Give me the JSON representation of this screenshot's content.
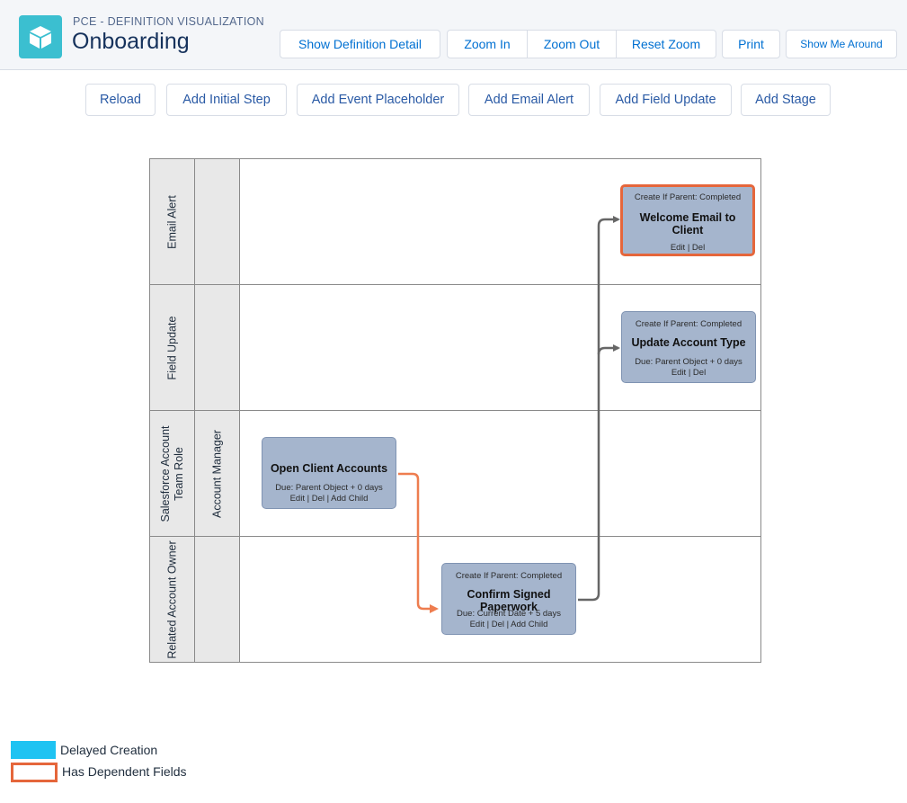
{
  "header": {
    "eyebrow": "PCE - DEFINITION VISUALIZATION",
    "title": "Onboarding",
    "app_icon": "cube-icon",
    "buttons": {
      "show_definition_detail": "Show Definition Detail",
      "zoom_in": "Zoom In",
      "zoom_out": "Zoom Out",
      "reset_zoom": "Reset Zoom",
      "print": "Print",
      "show_me_around": "Show Me Around"
    }
  },
  "toolbar": {
    "reload": "Reload",
    "add_initial_step": "Add Initial Step",
    "add_event_placeholder": "Add Event Placeholder",
    "add_email_alert": "Add Email Alert",
    "add_field_update": "Add Field Update",
    "add_stage": "Add Stage"
  },
  "lanes": [
    {
      "label": "Email Alert",
      "sublabel": ""
    },
    {
      "label": "Field Update",
      "sublabel": ""
    },
    {
      "label": "Salesforce Account Team Role",
      "sublabel": "Account Manager"
    },
    {
      "label": "Related Account Owner",
      "sublabel": ""
    }
  ],
  "nodes": {
    "welcome_email": {
      "pre": "Create If Parent: Completed",
      "name": "Welcome Email to Client",
      "due": "",
      "actions": "Edit | Del",
      "has_dependent_fields": true
    },
    "update_account_type": {
      "pre": "Create If Parent: Completed",
      "name": "Update Account Type",
      "due": "Due: Parent Object + 0 days",
      "actions": "Edit | Del",
      "has_dependent_fields": false
    },
    "open_client_accounts": {
      "pre": "",
      "name": "Open Client Accounts",
      "due": "Due: Parent Object + 0 days",
      "actions": "Edit | Del | Add Child",
      "has_dependent_fields": false
    },
    "confirm_signed_paperwork": {
      "pre": "Create If Parent: Completed",
      "name": "Confirm Signed Paperwork",
      "due": "Due: Current Date + 5 days",
      "actions": "Edit | Del | Add Child",
      "has_dependent_fields": false
    }
  },
  "legend": [
    {
      "label": "Delayed Creation",
      "color": "#1fc3f2"
    },
    {
      "label": "Has Dependent Fields",
      "color": "#e5663b"
    }
  ],
  "colors": {
    "node_fill": "#a5b5cd",
    "dependent_border": "#e5663b",
    "connector_gray": "#666666",
    "connector_orange": "#ee7d4f",
    "button_text": "#0070d2"
  }
}
